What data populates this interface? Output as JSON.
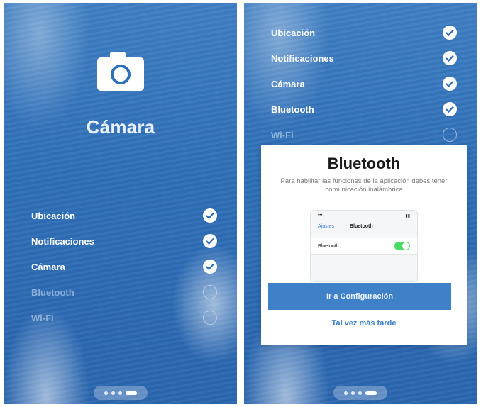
{
  "screen1": {
    "hero_title": "Cámara",
    "hero_icon": "camera-icon",
    "permissions": [
      {
        "label": "Ubicación",
        "status": "done"
      },
      {
        "label": "Notificaciones",
        "status": "done"
      },
      {
        "label": "Cámara",
        "status": "done"
      },
      {
        "label": "Bluetooth",
        "status": "pending"
      },
      {
        "label": "Wi-Fi",
        "status": "pending"
      }
    ],
    "page_indicator": {
      "total": 4,
      "active": 4
    }
  },
  "screen2": {
    "permissions": [
      {
        "label": "Ubicación",
        "status": "done"
      },
      {
        "label": "Notificaciones",
        "status": "done"
      },
      {
        "label": "Cámara",
        "status": "done"
      },
      {
        "label": "Bluetooth",
        "status": "done"
      },
      {
        "label": "Wi-Fi",
        "status": "pending"
      }
    ],
    "modal": {
      "title": "Bluetooth",
      "description": "Para habilitar las funciones de la aplicación debes tener comunicación inalámbrica",
      "mock": {
        "back_label": "Ajustes",
        "nav_title": "Bluetooth",
        "cell_label": "Bluetooth",
        "toggle_on": true
      },
      "primary_button": "Ir a Configuración",
      "secondary_link": "Tal vez más tarde"
    },
    "page_indicator": {
      "total": 4,
      "active": 4
    }
  },
  "colors": {
    "background_blue": "#2f6fb8",
    "button_blue": "#3f81c9",
    "toggle_green": "#4cd964"
  }
}
